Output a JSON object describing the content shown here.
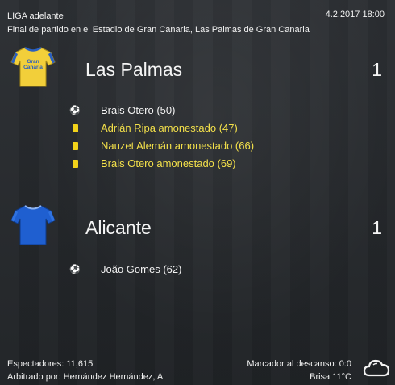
{
  "header": {
    "league": "LIGA adelante",
    "venue_line": "Final de partido en el Estadio de Gran Canaria, Las Palmas de Gran Canaria",
    "datetime": "4.2.2017 18:00"
  },
  "home": {
    "name": "Las Palmas",
    "score": "1",
    "shirt_icon": "yellow-shirt-icon",
    "shirt_color": "#f2cf3a",
    "shirt_trim": "#2a5fc0",
    "shirt_text": "Gran Canaria",
    "events": [
      {
        "type": "goal",
        "icon": "ball-icon",
        "text": "Brais Otero (50)"
      },
      {
        "type": "card",
        "icon": "yellow-card-icon",
        "text": "Adrián Ripa amonestado (47)"
      },
      {
        "type": "card",
        "icon": "yellow-card-icon",
        "text": "Nauzet Alemán amonestado (66)"
      },
      {
        "type": "card",
        "icon": "yellow-card-icon",
        "text": "Brais Otero amonestado (69)"
      }
    ]
  },
  "away": {
    "name": "Alicante",
    "score": "1",
    "shirt_icon": "blue-shirt-icon",
    "shirt_color": "#1f5fd0",
    "events": [
      {
        "type": "goal",
        "icon": "ball-icon",
        "text": "João Gomes (62)"
      }
    ]
  },
  "footer": {
    "spectators": "Espectadores: 11,615",
    "referee": "Arbitrado por: Hernández Hernández, A",
    "halftime": "Marcador al descanso: 0:0",
    "weather": "Brisa 11°C",
    "weather_icon": "cloud-icon"
  },
  "colors": {
    "card_text": "#f3e04a",
    "background": "#26292d"
  }
}
